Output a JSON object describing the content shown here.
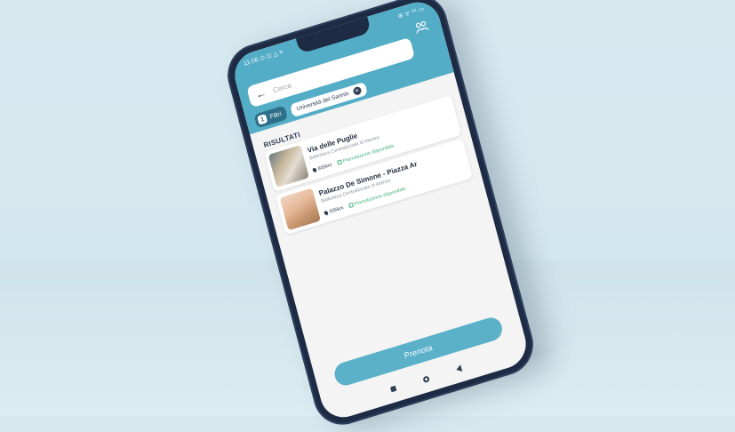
{
  "status_bar": {
    "time": "11:06",
    "icons": "⊙ ⊡ ◬ ≡",
    "right": "⊕ ᯤ ⁹⁵ ▭"
  },
  "header": {
    "search_placeholder": "Cerca",
    "map_icon": "map-users-icon",
    "filter_count": "1",
    "filter_label": "Filtri",
    "chip_label": "Università del Sannio"
  },
  "results": {
    "title": "RISULTATI",
    "items": [
      {
        "name": "Via delle Puglie",
        "subtitle": "Biblioteca Centralizzata di Ateneo",
        "distance": "935km",
        "availability": "Prenotazione disponibile"
      },
      {
        "name": "Palazzo De Simone - Piazza Ar",
        "subtitle": "Biblioteca Centralizzata di Ateneo",
        "distance": "935km",
        "availability": "Prenotazione disponibile"
      }
    ]
  },
  "actions": {
    "book_label": "Prenota"
  },
  "colors": {
    "accent": "#54adc6",
    "dark": "#2d3e55",
    "success": "#46b07b",
    "frame": "#1d2b44"
  }
}
